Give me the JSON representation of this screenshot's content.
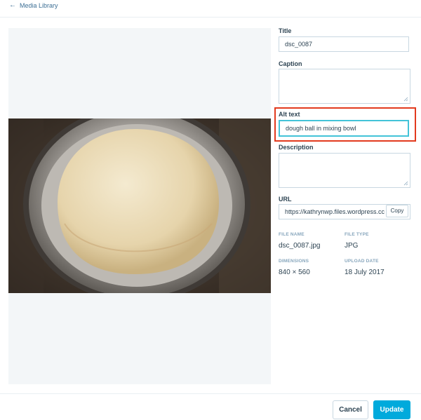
{
  "header": {
    "back_label": "Media Library"
  },
  "fields": {
    "title": {
      "label": "Title",
      "value": "dsc_0087"
    },
    "caption": {
      "label": "Caption",
      "value": ""
    },
    "alt_text": {
      "label": "Alt text",
      "value": "dough ball in mixing bowl"
    },
    "description": {
      "label": "Description",
      "value": ""
    },
    "url": {
      "label": "URL",
      "value": "https://kathrynwp.files.wordpress.cc",
      "copy_label": "Copy"
    }
  },
  "meta": {
    "file_name": {
      "label": "FILE NAME",
      "value": "dsc_0087.jpg"
    },
    "file_type": {
      "label": "FILE TYPE",
      "value": "JPG"
    },
    "dimensions": {
      "label": "DIMENSIONS",
      "value": "840 × 560"
    },
    "upload_date": {
      "label": "UPLOAD DATE",
      "value": "18 July 2017"
    }
  },
  "actions": {
    "cancel_label": "Cancel",
    "update_label": "Update"
  },
  "colors": {
    "accent": "#00aadc",
    "highlight": "#e23a1e",
    "focus": "#43c3d8"
  },
  "image": {
    "subject": "dough-photo"
  }
}
